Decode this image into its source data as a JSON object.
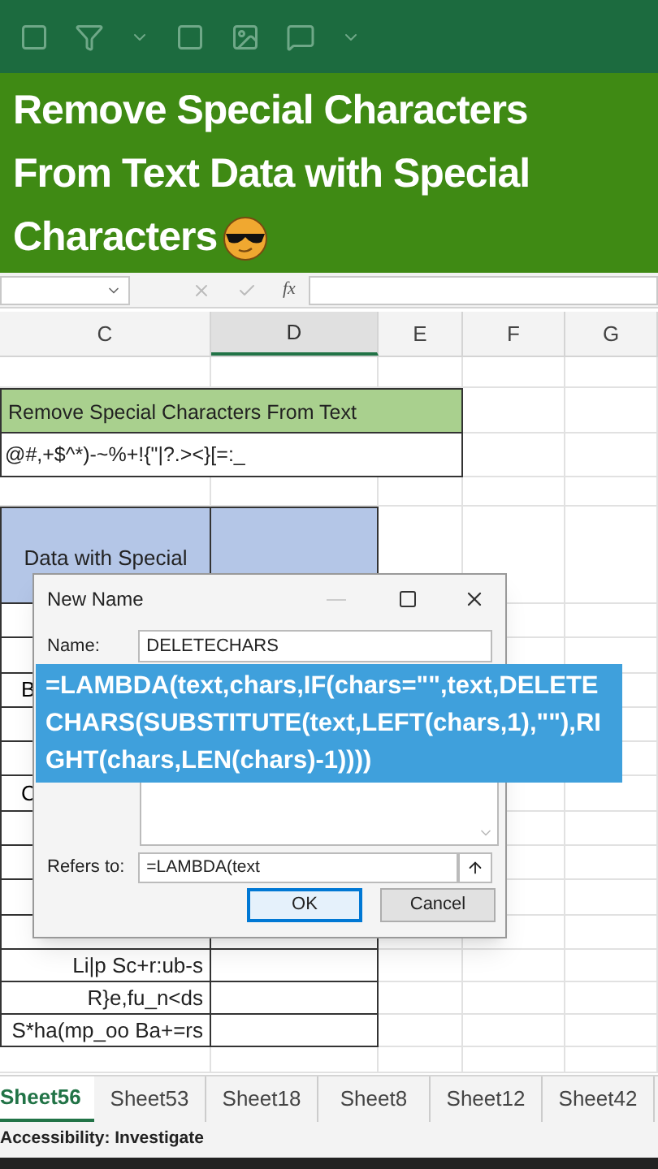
{
  "banner": {
    "lines": [
      "Remove Special Characters",
      "From Text Data with Special",
      "Characters"
    ]
  },
  "columns": [
    {
      "label": "C",
      "selected": false
    },
    {
      "label": "D",
      "selected": true
    },
    {
      "label": "E",
      "selected": false
    },
    {
      "label": "F",
      "selected": false
    },
    {
      "label": "G",
      "selected": false
    }
  ],
  "formula_bar": {
    "function_label": "fx"
  },
  "sheet": {
    "title": "Remove Special Characters From Text",
    "chars": "@#,+$^*)-~%+!{\"|?.><}[=:_",
    "header": "Data with Special",
    "partial_cells": [
      "B",
      "C"
    ],
    "rows": [
      "Li|p Sc+r:ub-s",
      "R}e,fu_n<ds",
      "S*ha(mp_oo Ba+=rs"
    ]
  },
  "dialog": {
    "title": "New Name",
    "name_label": "Name:",
    "name_value": "DELETECHARS",
    "refers_label": "Refers to:",
    "refers_value": "=LAMBDA(text",
    "buttons": [
      {
        "label": "OK",
        "default": true
      },
      {
        "label": "Cancel",
        "default": false
      }
    ]
  },
  "formula_overlay": "=LAMBDA(text,chars,IF(chars=\"\",text,DELETECHARS(SUBSTITUTE(text,LEFT(chars,1),\"\"),RIGHT(chars,LEN(chars)-1))))",
  "sheet_tabs": [
    {
      "label": "Sheet56",
      "selected": true
    },
    {
      "label": "Sheet53",
      "selected": false
    },
    {
      "label": "Sheet18",
      "selected": false
    },
    {
      "label": "Sheet8",
      "selected": false
    },
    {
      "label": "Sheet12",
      "selected": false
    },
    {
      "label": "Sheet42",
      "selected": false
    }
  ],
  "status_bar": {
    "text": "Accessibility: Investigate"
  }
}
